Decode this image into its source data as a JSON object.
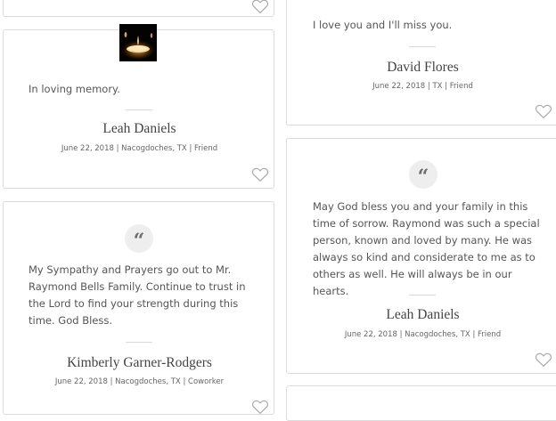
{
  "cards": {
    "top_left": {},
    "leah_photo": {
      "message": "In loving memory.",
      "name": "Leah Daniels",
      "meta": "June 22, 2018 | Nacogdoches, TX | Friend"
    },
    "kimberly": {
      "quote_icon": "quote-icon",
      "message": "My Sympathy and Prayers go out to Mr. Raymond Bells Family. Continue to trust in the Lord to find your strength during this time. God Bless.",
      "name": "Kimberly Garner-Rodgers",
      "meta": "June 22, 2018 | Nacogdoches, TX | Coworker"
    },
    "david": {
      "message": "I love you and I'll miss you.",
      "name": "David Flores",
      "meta": "June 22, 2018 | TX | Friend"
    },
    "leah_quote": {
      "quote_icon": "quote-icon",
      "message": "May God bless you and your family in this time of sorrow. Raymond was such a special person, known and loved by many. He was always so kind and considerate to me as to others as well. He will always be in our hearts.",
      "name": "Leah Daniels",
      "meta": "June 22, 2018 | Nacogdoches, TX | Friend"
    }
  },
  "icons": {
    "like": "heart-icon",
    "photo": "candle-photo"
  },
  "colors": {
    "border": "#dcdcdc",
    "text": "#555555",
    "quote_bg": "#eeeeee"
  }
}
